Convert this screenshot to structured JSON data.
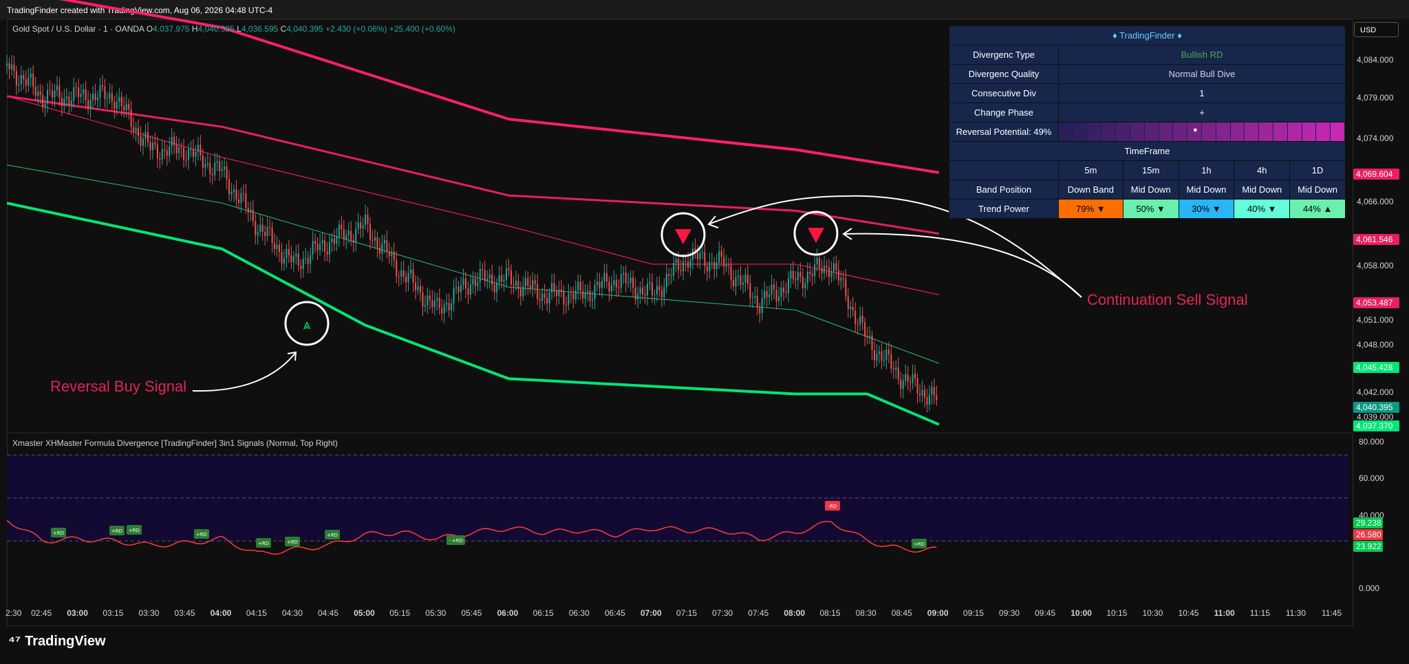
{
  "header": {
    "title": "TradingFinder created with TradingView.com, Aug 06, 2026 04:48 UTC-4"
  },
  "legend": {
    "symbol": "Gold Spot / U.S. Dollar · 1 · OANDA",
    "o_label": "O",
    "o": "4,037.975",
    "h_label": "H",
    "h": "4,040.395",
    "l_label": "L",
    "l": "4,036.595",
    "c_label": "C",
    "c": "4,040.395",
    "chg": "+2.430 (+0.06%)",
    "chg2": "+25.400 (+0.60%)"
  },
  "currency_button": "USD",
  "indicator_title": "Xmaster XHMaster Formula Divergence [TradingFinder] 3in1 Signals (Normal, Top Right)",
  "brand": "TradingView",
  "annotations": {
    "buy": "Reversal Buy Signal",
    "sell": "Continuation Sell Signal"
  },
  "price_axis": {
    "ticks": [
      "4,084.000",
      "4,079.000",
      "4,074.000",
      "4,066.000",
      "4,058.000",
      "4,051.000",
      "4,048.000",
      "4,042.000",
      "4,039.000"
    ],
    "partial_ticks": [
      "4,069.000",
      "4,062.000",
      "4,054.000"
    ],
    "tags": [
      {
        "text": "4,069.604",
        "color": "#e91e63"
      },
      {
        "text": "4,061.546",
        "color": "#e91e63"
      },
      {
        "text": "4,053.487",
        "color": "#e91e63"
      },
      {
        "text": "4,045.428",
        "color": "#00e676"
      },
      {
        "text": "4,040.395",
        "color": "#089981"
      },
      {
        "text": "4,037.370",
        "color": "#00e676"
      }
    ]
  },
  "osc_axis": {
    "ticks": [
      "80.000",
      "60.000",
      "40.000",
      "0.000"
    ],
    "tags": [
      {
        "text": "29.238",
        "color": "#00c853"
      },
      {
        "text": "26.580",
        "color": "#f23645"
      },
      {
        "text": "23.922",
        "color": "#00c853"
      }
    ]
  },
  "time_axis": {
    "labels": [
      "2:30",
      "02:45",
      "03:00",
      "03:15",
      "03:30",
      "03:45",
      "04:00",
      "04:15",
      "04:30",
      "04:45",
      "05:00",
      "05:15",
      "05:30",
      "05:45",
      "06:00",
      "06:15",
      "06:30",
      "06:45",
      "07:00",
      "07:15",
      "07:30",
      "07:45",
      "08:00",
      "08:15",
      "08:30",
      "08:45",
      "09:00",
      "09:15",
      "09:30",
      "09:45",
      "10:00",
      "10:15",
      "10:30",
      "10:45",
      "11:00",
      "11:15",
      "11:30",
      "11:45"
    ],
    "bold": [
      "03:00",
      "04:00",
      "05:00",
      "06:00",
      "07:00",
      "08:00",
      "09:00",
      "10:00",
      "11:00"
    ]
  },
  "table": {
    "title": "♦ TradingFinder ♦",
    "rows": [
      {
        "label": "Divergenc Type",
        "value": "Bullish RD",
        "color": "#4caf50"
      },
      {
        "label": "Divergenc Quality",
        "value": "Normal Bull Dive",
        "color": "#d1d4dc"
      },
      {
        "label": "Consecutive Div",
        "value": "1",
        "color": "#ffffff"
      },
      {
        "label": "Change Phase",
        "value": "+",
        "color": "#ffffff"
      }
    ],
    "reversal_label": "Reversal Potential: 49%",
    "reversal_marker": "●",
    "timeframe_header": "TimeFrame",
    "timeframes": [
      "5m",
      "15m",
      "1h",
      "4h",
      "1D"
    ],
    "band_label": "Band Position",
    "band_values": [
      "Down Band",
      "Mid Down",
      "Mid Down",
      "Mid Down",
      "Mid Down"
    ],
    "trend_label": "Trend Power",
    "trend_values": [
      "79% ▼",
      "50% ▼",
      "30% ▼",
      "40% ▼",
      "44% ▲"
    ],
    "trend_colors": [
      "#ff6f00",
      "#69f0ae",
      "#29b6f6",
      "#64ffda",
      "#69f0ae"
    ]
  },
  "chart_data": {
    "type": "line",
    "title": "Gold Spot / U.S. Dollar · 1 · OANDA",
    "x_range": [
      "02:30",
      "11:45"
    ],
    "y_range": [
      4036,
      4089
    ],
    "series": [
      {
        "name": "",
        "color": "#26a69a",
        "x": [
          "02:30",
          "02:45",
          "03:00",
          "03:15",
          "03:30",
          "03:45",
          "04:00",
          "04:15",
          "04:30",
          "04:45",
          "05:00",
          "05:15",
          "05:30",
          "05:45",
          "06:00",
          "06:15",
          "06:30",
          "06:45",
          "07:00",
          "07:15",
          "07:30",
          "07:45",
          "08:00",
          "08:15",
          "08:30",
          "08:45",
          "09:00"
        ],
        "y": [
          4084,
          4080,
          4080,
          4080,
          4073,
          4073,
          4070,
          4063,
          4058,
          4061,
          4063,
          4057,
          4052,
          4056,
          4056,
          4054,
          4054,
          4056,
          4054,
          4059,
          4058,
          4053,
          4056,
          4058,
          4048,
          4043,
          4040
        ]
      },
      {
        "name": "",
        "color": "#ff1f6b",
        "x": [
          "02:30",
          "04:00",
          "06:00",
          "08:00",
          "09:00"
        ],
        "y": [
          4094,
          4089,
          4077,
          4073,
          4070
        ]
      },
      {
        "name": "",
        "color": "#e91e63",
        "x": [
          "02:30",
          "04:00",
          "06:00",
          "08:00",
          "09:00"
        ],
        "y": [
          4080,
          4076,
          4067,
          4065,
          4062
        ]
      },
      {
        "name": "",
        "color": "#e91e63",
        "x": [
          "02:30",
          "04:00",
          "06:00",
          "07:00",
          "08:00",
          "09:00"
        ],
        "y": [
          4080,
          4072,
          4063,
          4058,
          4058,
          4054
        ]
      },
      {
        "name": "",
        "color": "#26c281",
        "x": [
          "02:30",
          "04:00",
          "06:00",
          "08:00",
          "09:00"
        ],
        "y": [
          4071,
          4066,
          4055,
          4052,
          4045
        ]
      },
      {
        "name": "",
        "color": "#00e676",
        "x": [
          "02:30",
          "04:00",
          "05:00",
          "06:00",
          "07:00",
          "08:00",
          "08:30",
          "09:00"
        ],
        "y": [
          4066,
          4060,
          4050,
          4043,
          4042,
          4041,
          4041,
          4037
        ]
      }
    ],
    "oscillator": {
      "y_range": [
        0,
        80
      ],
      "x": [
        "02:30",
        "02:45",
        "03:00",
        "03:15",
        "03:30",
        "03:45",
        "04:00",
        "04:15",
        "04:30",
        "04:45",
        "05:00",
        "05:15",
        "05:30",
        "05:45",
        "06:00",
        "06:15",
        "06:30",
        "06:45",
        "07:00",
        "07:15",
        "07:30",
        "07:45",
        "08:00",
        "08:15",
        "08:30",
        "08:45",
        "09:00"
      ],
      "y": [
        40,
        30,
        31,
        30,
        28,
        29,
        31,
        24,
        26,
        28,
        33,
        34,
        31,
        34,
        36,
        34,
        35,
        33,
        36,
        35,
        35,
        31,
        34,
        39,
        30,
        26,
        26
      ],
      "levels": [
        70,
        50,
        30
      ],
      "div_labels": [
        "+RD",
        "+RD",
        "+RD",
        "+RD",
        "+RD",
        "+RD",
        "+RD",
        "+RD",
        "+RD",
        "-RD",
        "+RD"
      ]
    }
  }
}
